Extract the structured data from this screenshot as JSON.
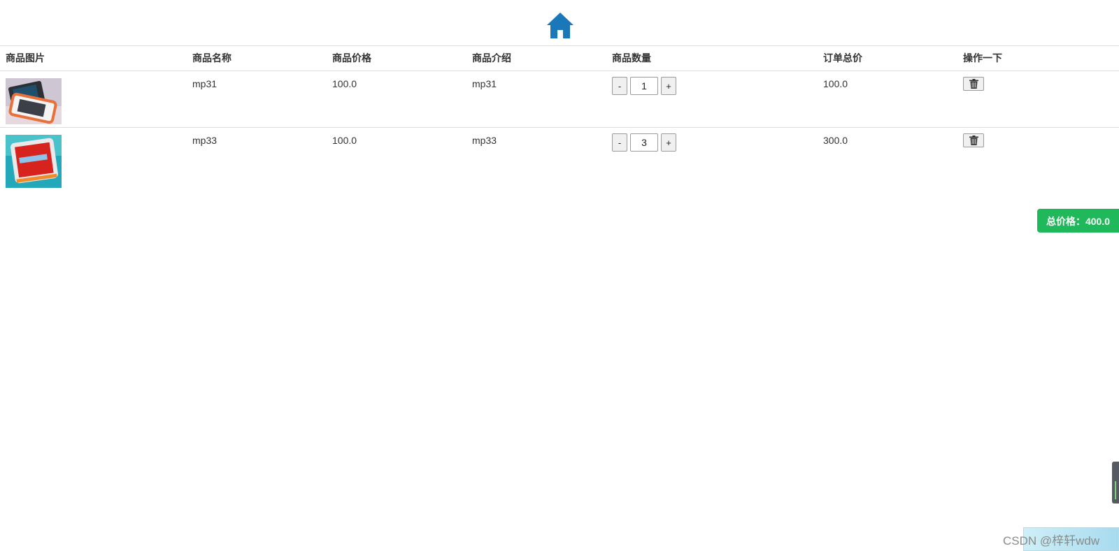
{
  "header": {
    "home_icon": "home-icon",
    "accent": "#1a78b8"
  },
  "table": {
    "columns": [
      "商品图片",
      "商品名称",
      "商品价格",
      "商品介绍",
      "商品数量",
      "订单总价",
      "操作一下"
    ],
    "rows": [
      {
        "name": "mp31",
        "price": "100.0",
        "intro": "mp31",
        "quantity": "1",
        "subtotal": "100.0"
      },
      {
        "name": "mp33",
        "price": "100.0",
        "intro": "mp33",
        "quantity": "3",
        "subtotal": "300.0"
      }
    ],
    "decrement_label": "-",
    "increment_label": "+",
    "delete_icon": "trash-icon"
  },
  "summary": {
    "total_label": "总价格：400.0",
    "color": "#1fb85b"
  },
  "watermark": "CSDN @梓轩wdw"
}
